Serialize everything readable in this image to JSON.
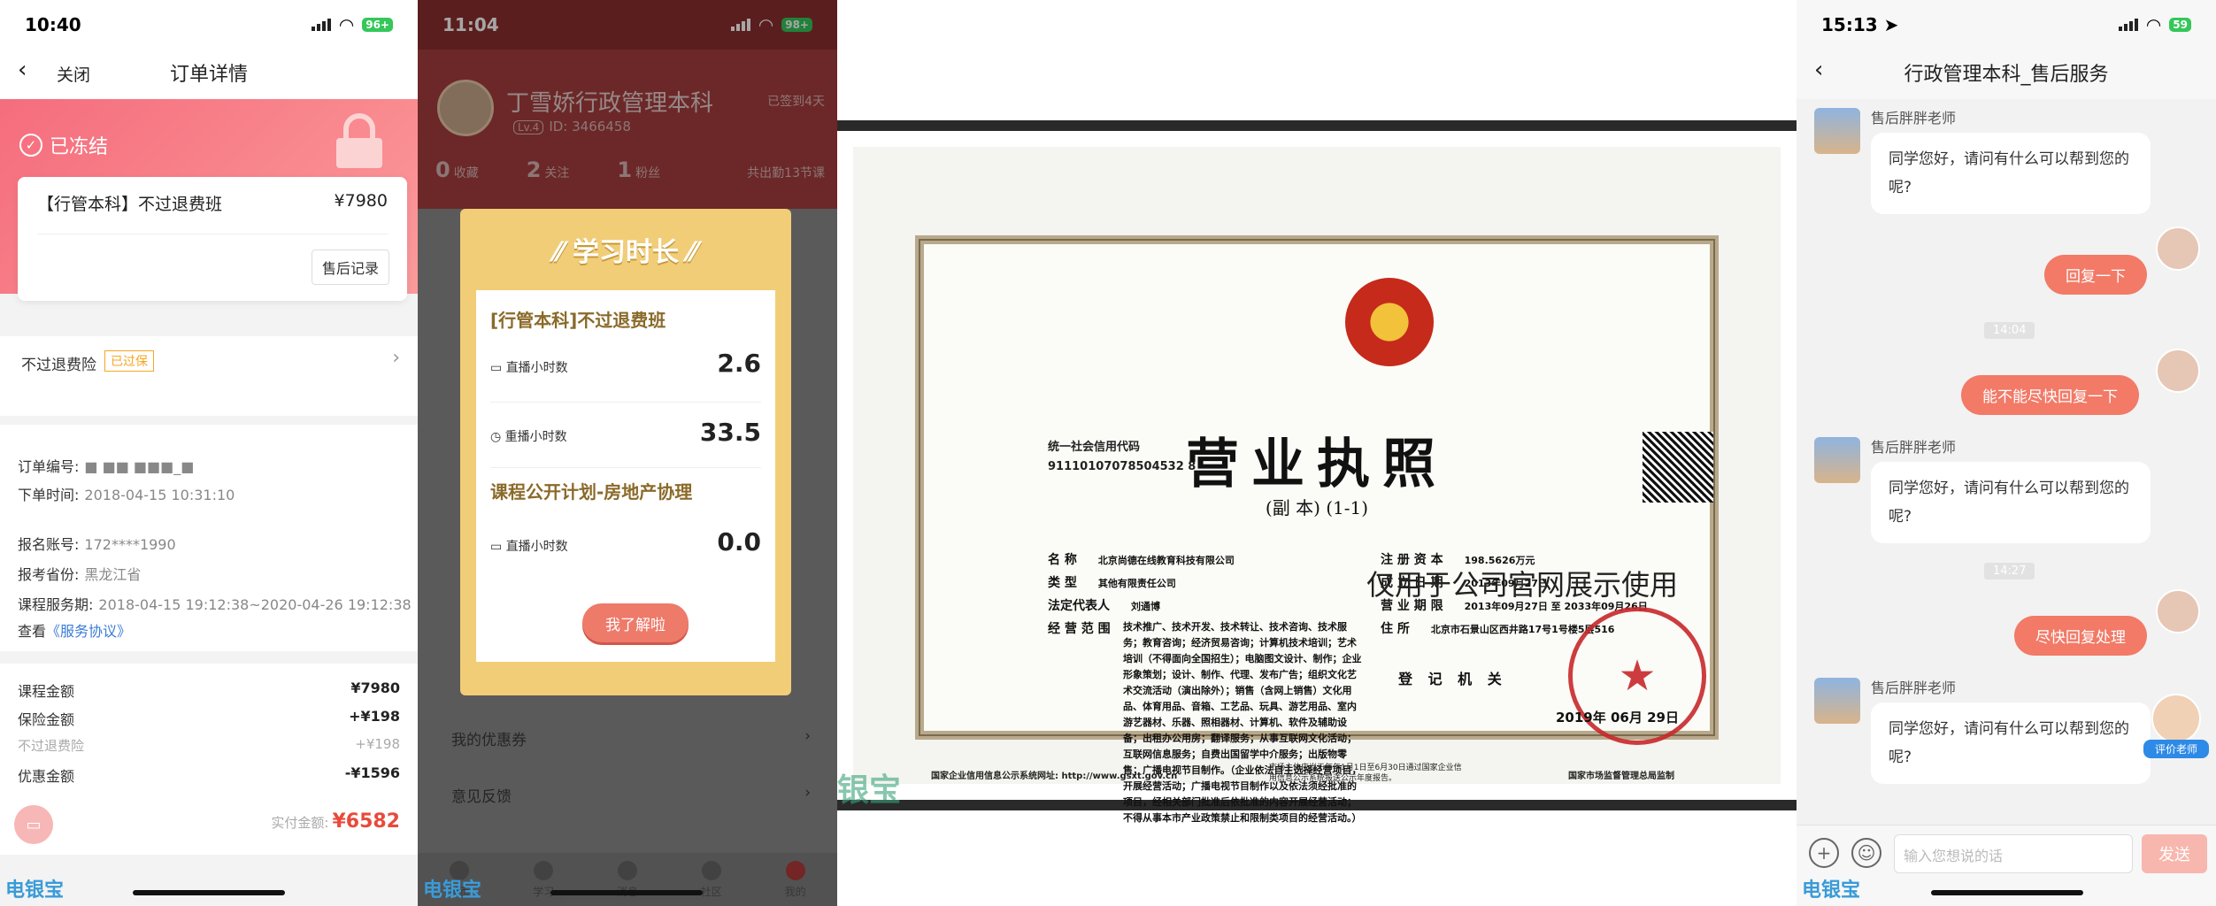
{
  "p1": {
    "status": {
      "time": "10:40",
      "battery": "96+"
    },
    "nav": {
      "back": "‹",
      "close": "关闭",
      "title": "订单详情"
    },
    "frozen": "已冻结",
    "course": {
      "name": "【行管本科】不过退费班",
      "price": "¥7980",
      "after_sales": "售后记录"
    },
    "insurance": {
      "label": "不过退费险",
      "tag": "已过保"
    },
    "info": [
      {
        "k": "订单编号:",
        "v": "■ ■■ ■■■_■"
      },
      {
        "k": "下单时间:",
        "v": "2018-04-15 10:31:10"
      },
      {
        "k": "报名账号:",
        "v": "172****1990"
      },
      {
        "k": "报考省份:",
        "v": "黑龙江省"
      },
      {
        "k": "课程服务期:",
        "v": "2018-04-15 19:12:38~2020-04-26 19:12:38"
      }
    ],
    "view": {
      "k": "查看",
      "link": "《服务协议》"
    },
    "amounts": [
      {
        "k": "课程金额",
        "v": "¥7980"
      },
      {
        "k": "保险金额",
        "v": "+¥198"
      },
      {
        "k": "不过退费险",
        "v": "+¥198"
      },
      {
        "k": "优惠金额",
        "v": "-¥1596"
      }
    ],
    "paid_label": "实付金额:",
    "paid_value": "¥6582",
    "watermark": "电银宝"
  },
  "p2": {
    "status": {
      "time": "11:04",
      "battery": "98+"
    },
    "username": "丁雪娇行政管理本科",
    "level": "Lv.4",
    "uid": "ID: 3466458",
    "joined": "已签到4天",
    "stats": [
      {
        "n": "0",
        "l": "收藏"
      },
      {
        "n": "2",
        "l": "关注"
      },
      {
        "n": "1",
        "l": "粉丝"
      }
    ],
    "streak": "共出勤13节课",
    "menu": [
      {
        "label": "我的优惠券"
      },
      {
        "label": "意见反馈"
      }
    ],
    "tabs": [
      "首页",
      "学习",
      "消息",
      "社区",
      "我的"
    ],
    "modal": {
      "title": "学习时长",
      "course1": "[行管本科]不过退费班",
      "live_label": "直播小时数",
      "live_value": "2.6",
      "replay_label": "重播小时数",
      "replay_value": "33.5",
      "course2": "课程公开计划-房地产协理",
      "live2_value": "0.0",
      "ok": "我了解啦"
    },
    "watermark": "电银宝"
  },
  "p3": {
    "credit_label": "统一社会信用代码",
    "credit_code": "91110107078504532 8",
    "title": "营业执照",
    "subtitle": "(副  本)  (1-1)",
    "fields_left": [
      {
        "k": "名          称",
        "v": "北京尚德在线教育科技有限公司"
      },
      {
        "k": "类          型",
        "v": "其他有限责任公司"
      },
      {
        "k": "法定代表人",
        "v": "刘通博"
      },
      {
        "k": "经 营 范 围",
        "v": ""
      }
    ],
    "scope": "技术推广、技术开发、技术转让、技术咨询、技术服务；教育咨询；经济贸易咨询；计算机技术培训；艺术培训（不得面向全国招生）；电脑图文设计、制作；企业形象策划；设计、制作、代理、发布广告；组织文化艺术交流活动（演出除外）；销售（含网上销售）文化用品、体育用品、音箱、工艺品、玩具、游艺用品、室内游艺器材、乐器、照相器材、计算机、软件及辅助设备；出租办公用房；翻译服务；从事互联网文化活动；互联网信息服务；自费出国留学中介服务；出版物零售；广播电视节目制作。（企业依法自主选择经营项目，开展经营活动；广播电视节目制作以及依法须经批准的项目，经相关部门批准后依批准的内容开展经营活动；不得从事本市产业政策禁止和限制类项目的经营活动。）",
    "fields_right": [
      {
        "k": "注 册 资 本",
        "v": "198.5626万元"
      },
      {
        "k": "成 立 日 期",
        "v": "2013年09月27日"
      },
      {
        "k": "营 业 期 限",
        "v": "2013年09月27日 至 2033年09月26日"
      },
      {
        "k": "住          所",
        "v": "北京市石景山区西井路17号1号楼5层516"
      }
    ],
    "overlay": "仅用于公司官网展示使用",
    "reg": "登 记 机 关",
    "date": "2019年  06月  29日",
    "foot_left": "国家企业信用信息公示系统网址:     http://www.gsxt.gov.cn",
    "foot_mid": "市场主体应当于每年1月1日至6月30日通过国家企业信用信息公示系统报送公示年度报告。",
    "foot_right": "国家市场监督管理总局监制",
    "watermark": "银宝"
  },
  "p4": {
    "status": {
      "time": "15:13",
      "battery": "59"
    },
    "nav": {
      "back": "‹",
      "title": "行政管理本科_售后服务"
    },
    "sender": "售后胖胖老师",
    "msg_q": "同学您好，请问有什么可以帮到您的呢?",
    "r1": "回复一下",
    "t1": "14:04",
    "r2": "能不能尽快回复一下",
    "t2": "14:27",
    "r3": "尽快回复处理",
    "rate": "评价老师",
    "input_placeholder": "输入您想说的话",
    "send": "发送",
    "watermark": "电银宝"
  }
}
